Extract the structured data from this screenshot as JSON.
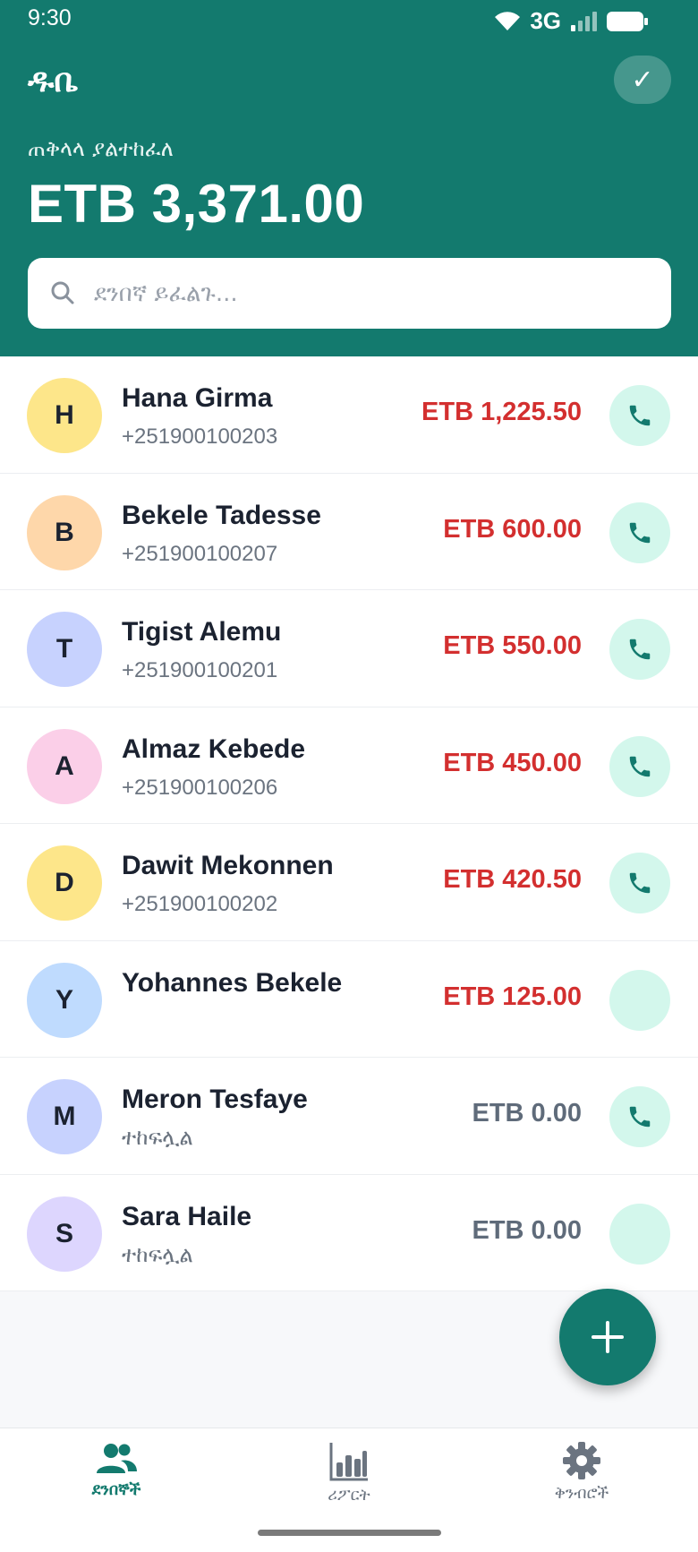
{
  "status_bar": {
    "time": "9:30",
    "network": "3G"
  },
  "header": {
    "app_title": "ዱቤ",
    "check_symbol": "✓",
    "total_label": "ጠቅላላ ያልተከፈለ",
    "total_amount": "ETB 3,371.00"
  },
  "search": {
    "placeholder": "ደንበኛ ይፈልጉ..."
  },
  "colors": {
    "primary": "#137a6e",
    "owed": "#d32f2f",
    "paid": "#5f6b7a",
    "call_bg": "#d3f7ec"
  },
  "customers": [
    {
      "initial": "H",
      "name": "Hana Girma",
      "sub": "+251900100203",
      "amount": "ETB 1,225.50",
      "status": "owed",
      "avatar_color": "#fde68a",
      "has_phone": true
    },
    {
      "initial": "B",
      "name": "Bekele Tadesse",
      "sub": "+251900100207",
      "amount": "ETB 600.00",
      "status": "owed",
      "avatar_color": "#fed7aa",
      "has_phone": true
    },
    {
      "initial": "T",
      "name": "Tigist Alemu",
      "sub": "+251900100201",
      "amount": "ETB 550.00",
      "status": "owed",
      "avatar_color": "#c7d2fe",
      "has_phone": true
    },
    {
      "initial": "A",
      "name": "Almaz Kebede",
      "sub": "+251900100206",
      "amount": "ETB 450.00",
      "status": "owed",
      "avatar_color": "#fbcfe8",
      "has_phone": true
    },
    {
      "initial": "D",
      "name": "Dawit Mekonnen",
      "sub": "+251900100202",
      "amount": "ETB 420.50",
      "status": "owed",
      "avatar_color": "#fde68a",
      "has_phone": true
    },
    {
      "initial": "Y",
      "name": "Yohannes Bekele",
      "sub": "",
      "amount": "ETB 125.00",
      "status": "owed",
      "avatar_color": "#bfdbfe",
      "has_phone": false
    },
    {
      "initial": "M",
      "name": "Meron Tesfaye",
      "sub": "ተከፍሏል",
      "amount": "ETB 0.00",
      "status": "paid",
      "avatar_color": "#c7d2fe",
      "has_phone": true
    },
    {
      "initial": "S",
      "name": "Sara Haile",
      "sub": "ተከፍሏል",
      "amount": "ETB 0.00",
      "status": "paid",
      "avatar_color": "#ddd6fe",
      "has_phone": false
    }
  ],
  "fab": {
    "icon": "plus-icon"
  },
  "bottom_nav": [
    {
      "label": "ደንበኞች",
      "icon": "users-icon",
      "active": true
    },
    {
      "label": "ሪፖርት",
      "icon": "bar-chart-icon",
      "active": false
    },
    {
      "label": "ቅንብሮች",
      "icon": "gear-icon",
      "active": false
    }
  ]
}
